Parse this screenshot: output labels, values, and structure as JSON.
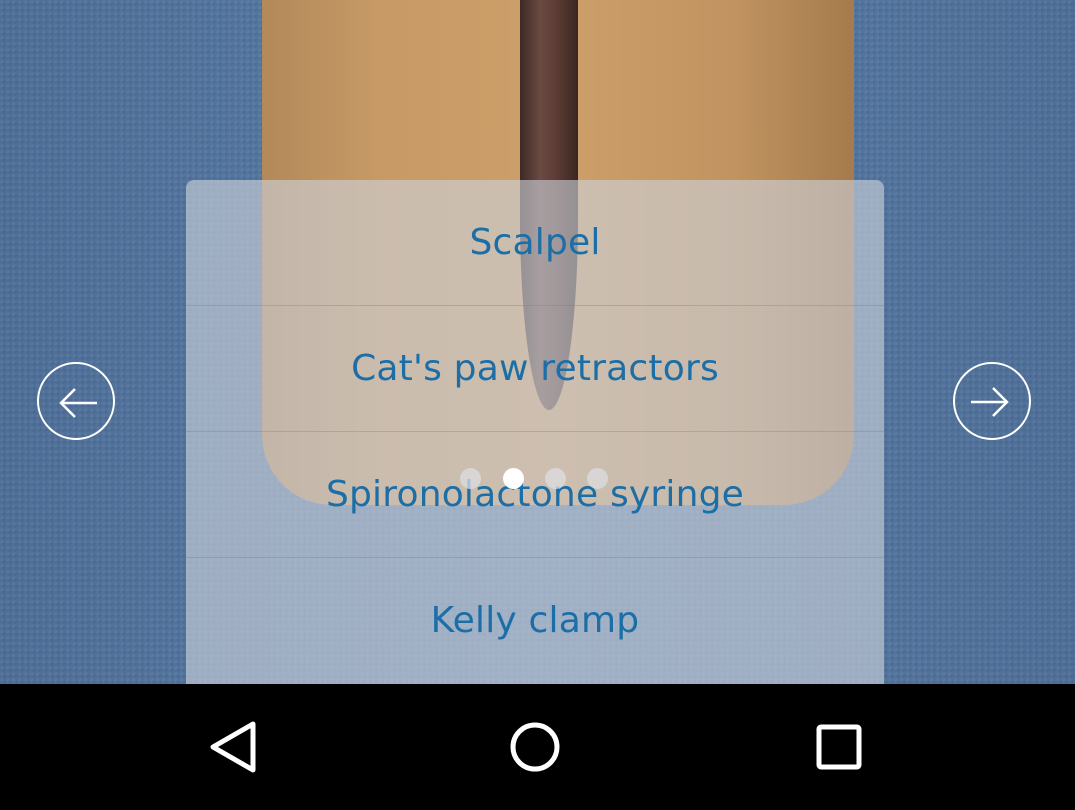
{
  "options": [
    {
      "label": "Scalpel"
    },
    {
      "label": "Cat's paw retractors"
    },
    {
      "label": "Spironolactone syringe"
    },
    {
      "label": "Kelly clamp"
    }
  ],
  "pager": {
    "total": 4,
    "active_index": 1
  },
  "icons": {
    "prev": "arrow-left-icon",
    "next": "arrow-right-icon",
    "back": "back-triangle-icon",
    "home": "home-circle-icon",
    "recents": "recents-square-icon"
  },
  "colors": {
    "option_text": "#1c6ea6",
    "drape": "#51739d",
    "navbar": "#000000"
  }
}
